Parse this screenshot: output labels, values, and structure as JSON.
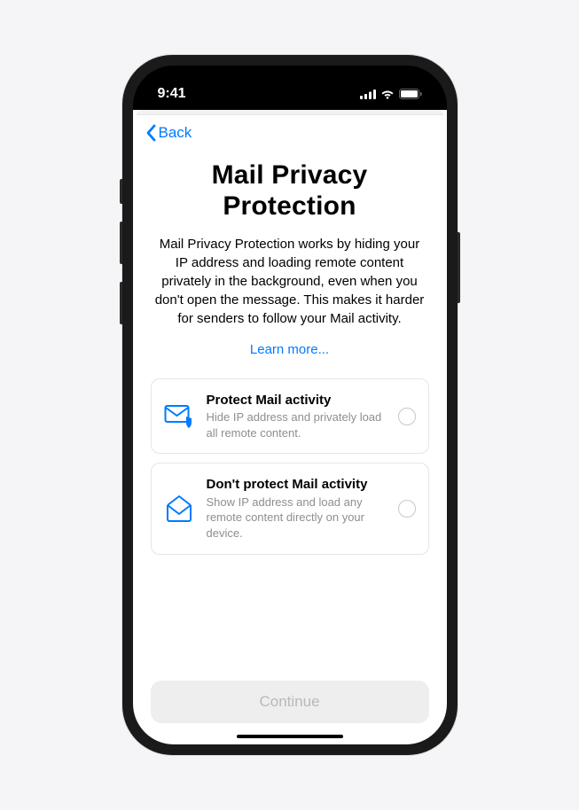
{
  "status_bar": {
    "time": "9:41"
  },
  "nav": {
    "back_label": "Back"
  },
  "page": {
    "title": "Mail Privacy Protection",
    "description": "Mail Privacy Protection works by hiding your IP address and loading remote content privately in the background, even when you don't open the message. This makes it harder for senders to follow your Mail activity.",
    "learn_more": "Learn more..."
  },
  "options": [
    {
      "title": "Protect Mail activity",
      "subtitle": "Hide IP address and privately load all remote content."
    },
    {
      "title": "Don't protect Mail activity",
      "subtitle": "Show IP address and load any remote content directly on your device."
    }
  ],
  "footer": {
    "continue_label": "Continue"
  }
}
